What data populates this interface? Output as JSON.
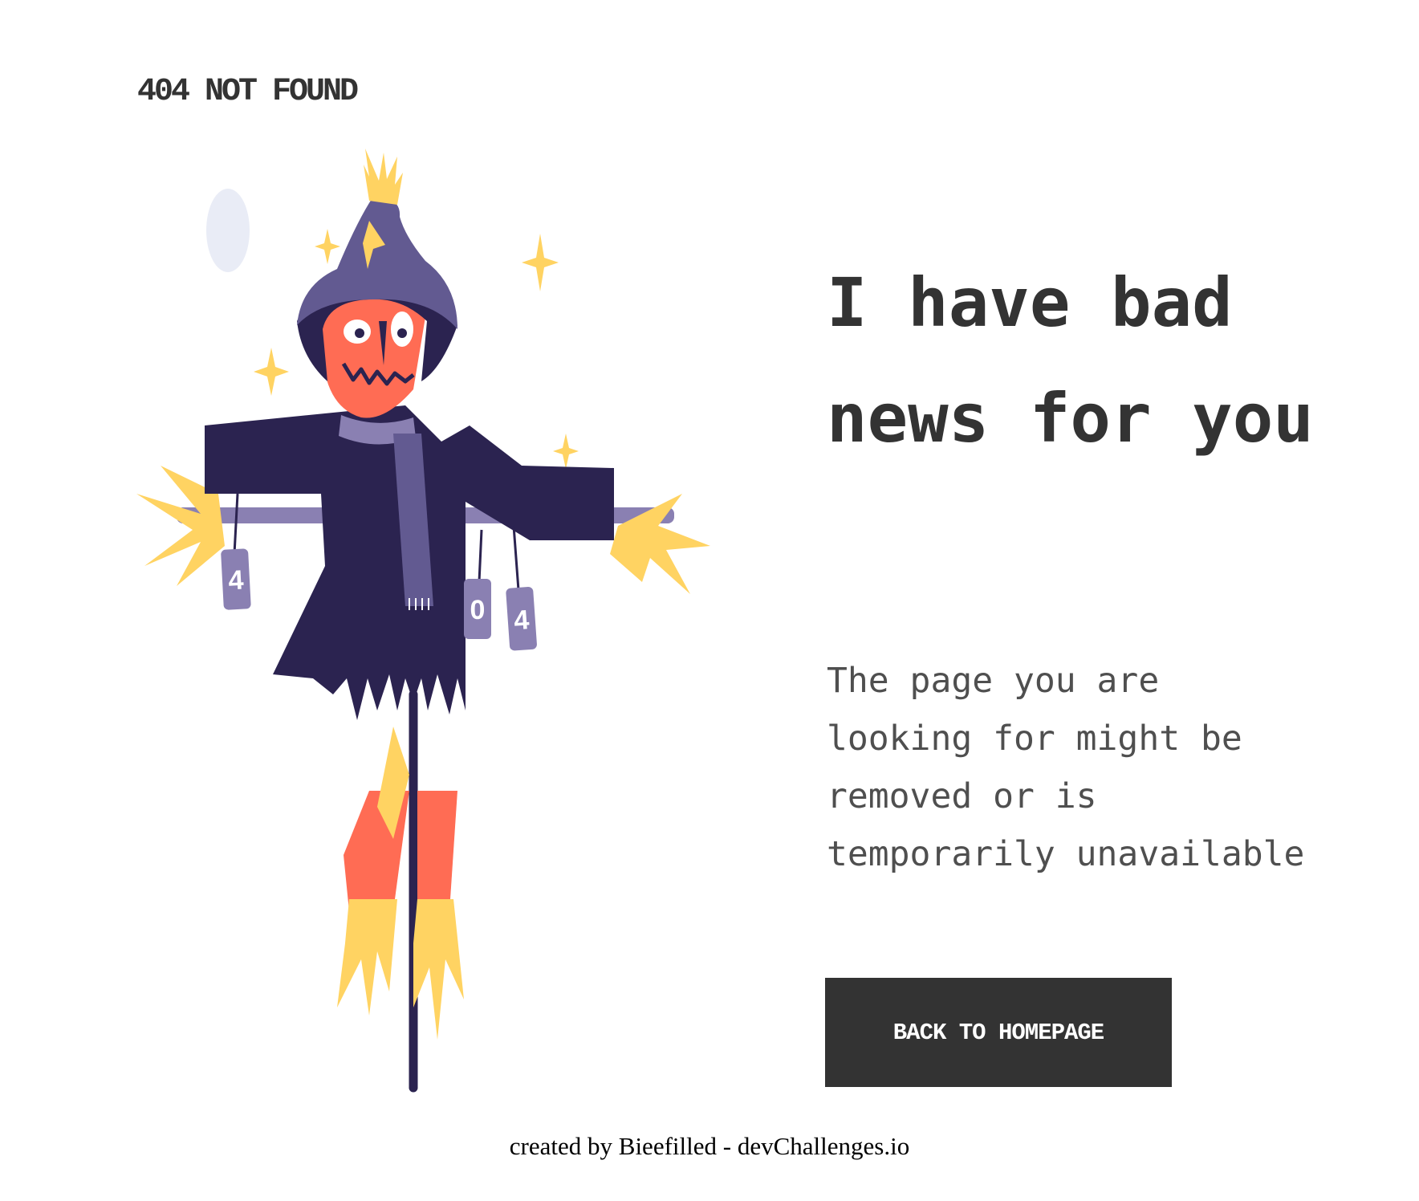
{
  "header": {
    "brand": "404 NOT FOUND"
  },
  "illustration": {
    "name": "scarecrow-illustration",
    "can_labels": [
      "4",
      "0",
      "4"
    ]
  },
  "main": {
    "headline": "I have bad news for you",
    "message": "The page you are looking for might be removed or is temporarily unavailable",
    "cta_label": "BACK TO HOMEPAGE"
  },
  "footer": {
    "prefix": "created by ",
    "author": "Bieefilled",
    "separator": " - ",
    "site": "devChallenges.io"
  },
  "colors": {
    "text": "#333333",
    "body_text": "#4F4F4F",
    "button_bg": "#333333",
    "button_text": "#FFFFFF",
    "hat": "#625A91",
    "coat": "#2B2350",
    "face": "#FF6C54",
    "straw": "#FFD362",
    "moon": "#E9ECF6"
  }
}
